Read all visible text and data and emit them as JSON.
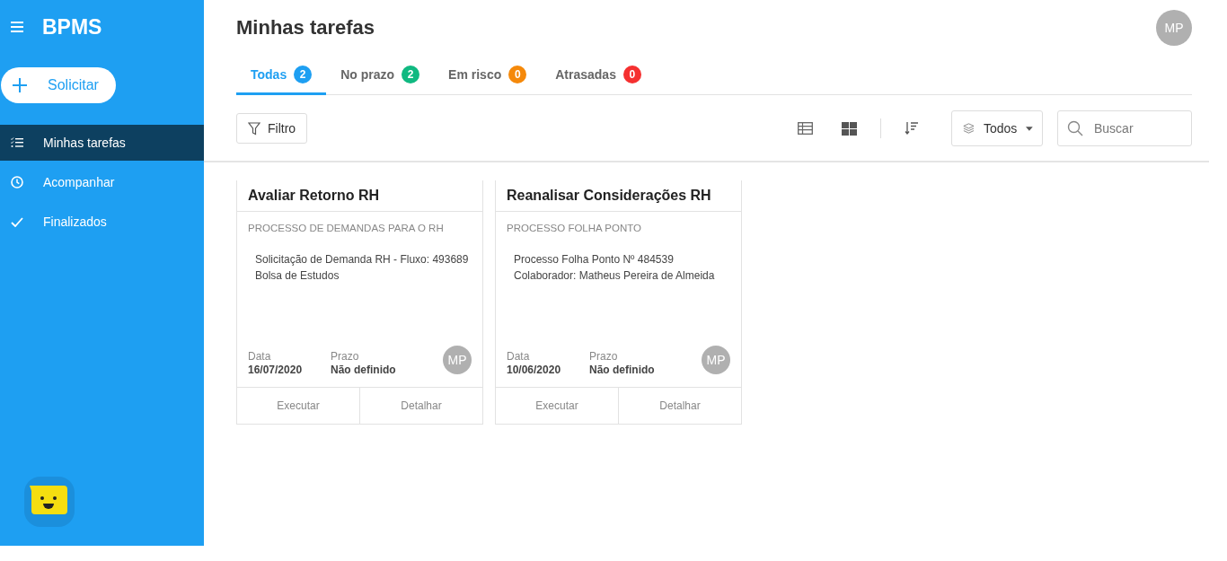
{
  "app": {
    "title": "BPMS"
  },
  "sidebar": {
    "action": "Solicitar",
    "items": [
      {
        "label": "Minhas tarefas",
        "selected": true
      },
      {
        "label": "Acompanhar",
        "selected": false
      },
      {
        "label": "Finalizados",
        "selected": false
      }
    ]
  },
  "header": {
    "title": "Minhas tarefas",
    "avatar": "MP"
  },
  "tabs": [
    {
      "label": "Todas",
      "count": "2",
      "color": "#1e9ff2",
      "selected": true
    },
    {
      "label": "No prazo",
      "count": "2",
      "color": "#10b981",
      "selected": false
    },
    {
      "label": "Em risco",
      "count": "0",
      "color": "#f5890a",
      "selected": false
    },
    {
      "label": "Atrasadas",
      "count": "0",
      "color": "#f53030",
      "selected": false
    }
  ],
  "toolbar": {
    "filter": "Filtro",
    "scope": "Todos",
    "search": {
      "placeholder": "Buscar"
    }
  },
  "cards": [
    {
      "title": "Avaliar Retorno RH",
      "process": "PROCESSO DE DEMANDAS PARA O RH",
      "lines": [
        "Solicitação de Demanda RH - Fluxo: 493689",
        "Bolsa de Estudos"
      ],
      "date_label": "Data",
      "date": "16/07/2020",
      "deadline_label": "Prazo",
      "deadline": "Não definido",
      "avatar": "MP",
      "actions": [
        "Executar",
        "Detalhar"
      ]
    },
    {
      "title": "Reanalisar Considerações RH",
      "process": "PROCESSO FOLHA PONTO",
      "lines": [
        "Processo Folha Ponto Nº 484539",
        "Colaborador: Matheus Pereira de Almeida"
      ],
      "date_label": "Data",
      "date": "10/06/2020",
      "deadline_label": "Prazo",
      "deadline": "Não definido",
      "avatar": "MP",
      "actions": [
        "Executar",
        "Detalhar"
      ]
    }
  ]
}
